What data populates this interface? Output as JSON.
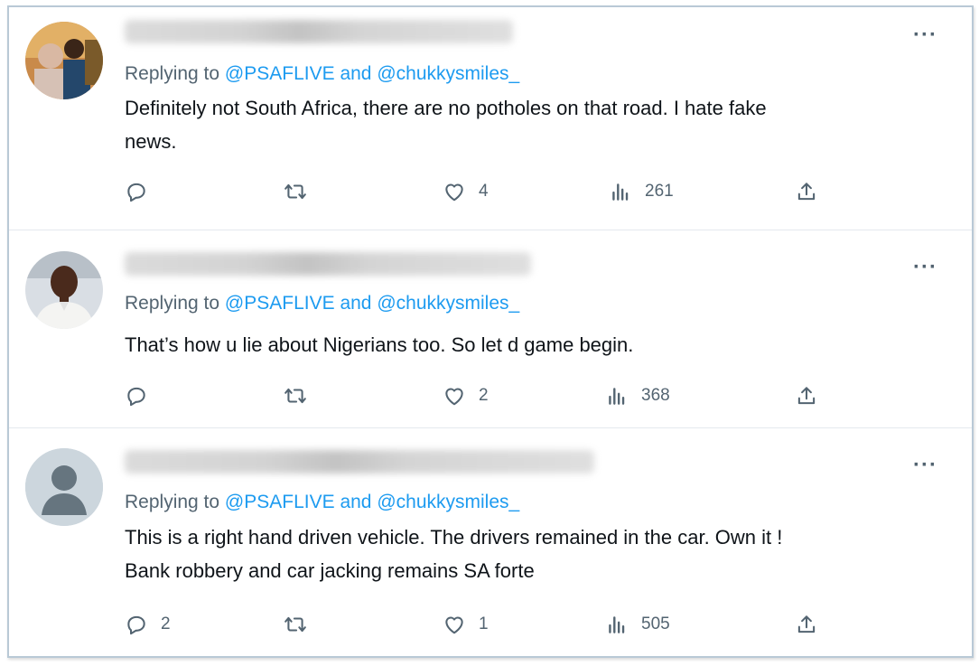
{
  "tweets": [
    {
      "replying_prefix": "Replying to",
      "mention1": "@PSAFLIVE",
      "and": "and",
      "mention2": "@chukkysmiles_",
      "text_line1": "Definitely not South Africa, there are no potholes on that road. I hate fake",
      "text_line2": "news.",
      "reply_count": "",
      "like_count": "4",
      "view_count": "261",
      "more": "···"
    },
    {
      "replying_prefix": "Replying to",
      "mention1": "@PSAFLIVE",
      "and": "and",
      "mention2": "@chukkysmiles_",
      "text_line1": "That’s how u lie about Nigerians too. So let d game begin.",
      "text_line2": "",
      "reply_count": "",
      "like_count": "2",
      "view_count": "368",
      "more": "···"
    },
    {
      "replying_prefix": "Replying to",
      "mention1": "@PSAFLIVE",
      "and": "and",
      "mention2": "@chukkysmiles_",
      "text_line1": "This is a right hand driven vehicle. The drivers remained in the car. Own it !",
      "text_line2": "Bank robbery and car jacking remains SA forte",
      "reply_count": "2",
      "like_count": "1",
      "view_count": "505",
      "more": "···"
    }
  ],
  "colors": {
    "mention": "#1d9bf0",
    "secondary_text": "#536471",
    "primary_text": "#0f1419",
    "frame_border": "#b9c9d6",
    "separator": "#e4e9ee"
  },
  "icons": [
    "reply-icon",
    "retweet-icon",
    "like-icon",
    "views-icon",
    "share-icon",
    "more-icon",
    "default-avatar-icon"
  ]
}
